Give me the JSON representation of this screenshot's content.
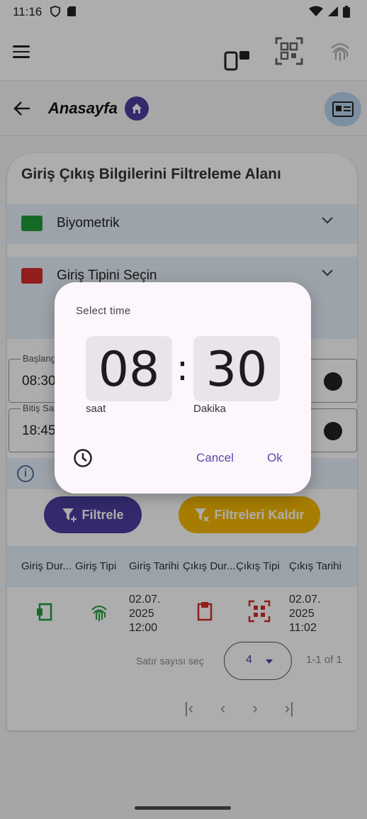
{
  "status_bar": {
    "time": "11:16"
  },
  "header": {
    "title": "Anasayfa"
  },
  "filter_card": {
    "title": "Giriş Çıkış Bilgilerini Filtreleme Alanı",
    "accordion_biometric": "Biyometrik",
    "accordion_type": "Giriş Tipini Seçin",
    "start_label": "Başlangıç Saati",
    "start_value": "08:30",
    "end_label": "Bitiş Saati",
    "end_value": "18:45",
    "filter_button": "Filtrele",
    "clear_button": "Filtreleri Kaldır"
  },
  "table": {
    "columns": [
      "Giriş Dur...",
      "Giriş Tipi",
      "Giriş Tarihi",
      "Çıkış Dur...",
      "Çıkış Tipi",
      "Çıkış Tarihi"
    ],
    "rows": [
      {
        "entry_date": "02.07.\n2025\n12:00",
        "exit_date": "02.07.\n2025\n11:02"
      }
    ]
  },
  "pagination": {
    "rows_per_page_label": "Satır sayısı seç",
    "rows_per_page_value": "4",
    "range": "1-1 of 1"
  },
  "time_picker": {
    "title": "Select time",
    "hour": "08",
    "minute": "30",
    "hour_label": "saat",
    "minute_label": "Dakika",
    "cancel": "Cancel",
    "ok": "Ok"
  },
  "colors": {
    "primary": "#4a3fa0",
    "accent": "#f5b800",
    "dialog_bg": "#fdf7fd",
    "time_box": "#e9e3ec"
  }
}
